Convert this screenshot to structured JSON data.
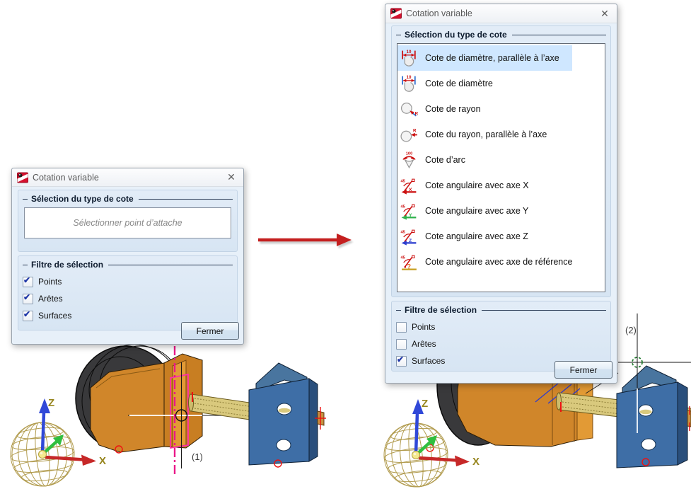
{
  "window_left": {
    "title": "Cotation variable",
    "close_icon": "✕",
    "type_group_label": "Sélection du type de cote",
    "attach_prompt": "Sélectionner point d’attache",
    "filter_group_label": "Filtre de sélection",
    "filters": [
      {
        "label": "Points",
        "checked": true
      },
      {
        "label": "Arêtes",
        "checked": true
      },
      {
        "label": "Surfaces",
        "checked": true
      }
    ],
    "close_button_label": "Fermer"
  },
  "window_right": {
    "title": "Cotation variable",
    "close_icon": "✕",
    "type_group_label": "Sélection du type de cote",
    "selected_index": 0,
    "dimension_types": [
      {
        "label": "Cote de diamètre, parallèle à l’axe",
        "icon": "diameter-parallel-axis-icon",
        "selected": true
      },
      {
        "label": "Cote de diamètre",
        "icon": "diameter-icon",
        "selected": false
      },
      {
        "label": "Cote de rayon",
        "icon": "radius-icon",
        "selected": false
      },
      {
        "label": "Cote du rayon, parallèle à l’axe",
        "icon": "radius-parallel-axis-icon",
        "selected": false
      },
      {
        "label": "Cote d’arc",
        "icon": "arc-icon",
        "selected": false
      },
      {
        "label": "Cote angulaire avec axe X",
        "icon": "angular-axis-x-icon",
        "selected": false
      },
      {
        "label": "Cote angulaire avec axe Y",
        "icon": "angular-axis-y-icon",
        "selected": false
      },
      {
        "label": "Cote angulaire avec axe Z",
        "icon": "angular-axis-z-icon",
        "selected": false
      },
      {
        "label": "Cote angulaire avec axe de référence",
        "icon": "angular-reference-axis-icon",
        "selected": false
      }
    ],
    "filter_group_label": "Filtre de sélection",
    "filters": [
      {
        "label": "Points",
        "checked": false
      },
      {
        "label": "Arêtes",
        "checked": false
      },
      {
        "label": "Surfaces",
        "checked": true
      }
    ],
    "close_button_label": "Fermer"
  },
  "scene": {
    "axis_x_label": "X",
    "axis_z_label": "Z",
    "annotation_left": "(1)",
    "annotation_right": "(2)"
  },
  "colors": {
    "selection_highlight": "#cfe7ff",
    "dialog_background": "#e7f0f9",
    "dimension_red": "#cc1111",
    "arrow_red": "#c41f1f",
    "centerline_magenta": "#ea1889",
    "selection_outline_pink": "#ff2fa8",
    "part_orange": "#d0862a",
    "part_blue": "#3e6ea6",
    "shaft_khaki": "#d9c97d",
    "wheel_dark": "#39393b",
    "sphere_wire_tan": "#b29c4f",
    "axis_label_olive": "#97861f",
    "axis_x_red": "#c62828",
    "axis_y_green": "#2fbf3f",
    "axis_z_blue": "#3048d8"
  }
}
